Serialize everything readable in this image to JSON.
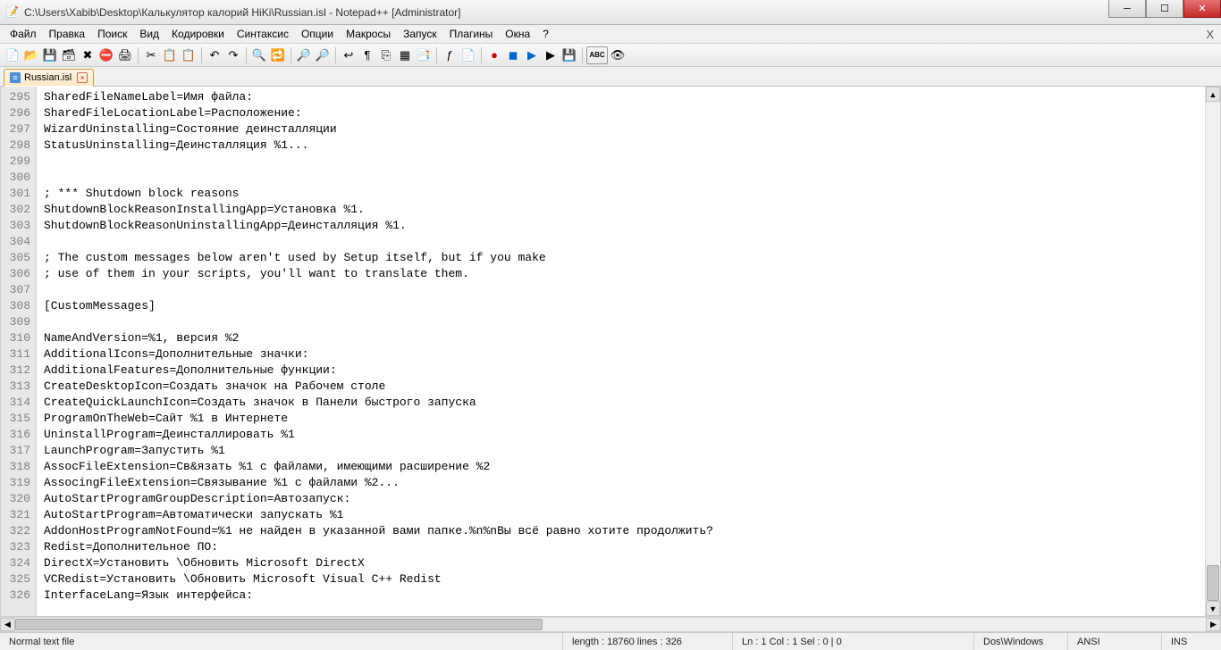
{
  "window": {
    "title": "C:\\Users\\Xabib\\Desktop\\Калькулятор калорий HiKi\\Russian.isl - Notepad++ [Administrator]"
  },
  "menu": {
    "items": [
      "Файл",
      "Правка",
      "Поиск",
      "Вид",
      "Кодировки",
      "Синтаксис",
      "Опции",
      "Макросы",
      "Запуск",
      "Плагины",
      "Окна",
      "?"
    ]
  },
  "tab": {
    "label": "Russian.isl"
  },
  "gutter": {
    "start": 295,
    "end": 326
  },
  "code": {
    "lines": [
      "SharedFileNameLabel=Имя файла:",
      "SharedFileLocationLabel=Расположение:",
      "WizardUninstalling=Состояние деинсталляции",
      "StatusUninstalling=Деинсталляция %1...",
      "",
      "",
      "; *** Shutdown block reasons",
      "ShutdownBlockReasonInstallingApp=Установка %1.",
      "ShutdownBlockReasonUninstallingApp=Деинсталляция %1.",
      "",
      "; The custom messages below aren't used by Setup itself, but if you make",
      "; use of them in your scripts, you'll want to translate them.",
      "",
      "[CustomMessages]",
      "",
      "NameAndVersion=%1, версия %2",
      "AdditionalIcons=Дополнительные значки:",
      "AdditionalFeatures=Дополнительные функции:",
      "CreateDesktopIcon=Создать значок на Рабочем столе",
      "CreateQuickLaunchIcon=Создать значок в Панели быстрого запуска",
      "ProgramOnTheWeb=Сайт %1 в Интернете",
      "UninstallProgram=Деинсталлировать %1",
      "LaunchProgram=Запустить %1",
      "AssocFileExtension=Св&язать %1 с файлами, имеющими расширение %2",
      "AssocingFileExtension=Связывание %1 с файлами %2...",
      "AutoStartProgramGroupDescription=Автозапуск:",
      "AutoStartProgram=Автоматически запускать %1",
      "AddonHostProgramNotFound=%1 не найден в указанной вами папке.%n%nВы всё равно хотите продолжить?",
      "Redist=Дополнительное ПО:",
      "DirectX=Установить \\Обновить Microsoft DirectX",
      "VCRedist=Установить \\Обновить Microsoft Visual C++ Redist",
      "InterfaceLang=Язык интерфейса:"
    ]
  },
  "status": {
    "filetype": "Normal text file",
    "length": "length : 18760    lines : 326",
    "pos": "Ln : 1    Col : 1    Sel : 0 | 0",
    "eol": "Dos\\Windows",
    "enc": "ANSI",
    "ins": "INS"
  },
  "icons": {
    "new": "📄",
    "open": "📂",
    "save": "💾",
    "saveall": "🗃",
    "close": "✖",
    "closeall": "⛔",
    "print": "🖨",
    "cut": "✂",
    "copy": "📋",
    "paste": "📋",
    "undo": "↶",
    "redo": "↷",
    "find": "🔍",
    "replace": "🔁",
    "zoomin": "🔎",
    "zoomout": "🔎",
    "wrap": "↩",
    "allchars": "¶",
    "guide": "⎘",
    "fold": "▦",
    "lang": "📑",
    "func": "ƒ",
    "doc": "📄",
    "rec": "●",
    "play": "▶",
    "stop": "◼",
    "playm": "▶",
    "savem": "💾",
    "abc": "ABC",
    "eye": "👁"
  }
}
